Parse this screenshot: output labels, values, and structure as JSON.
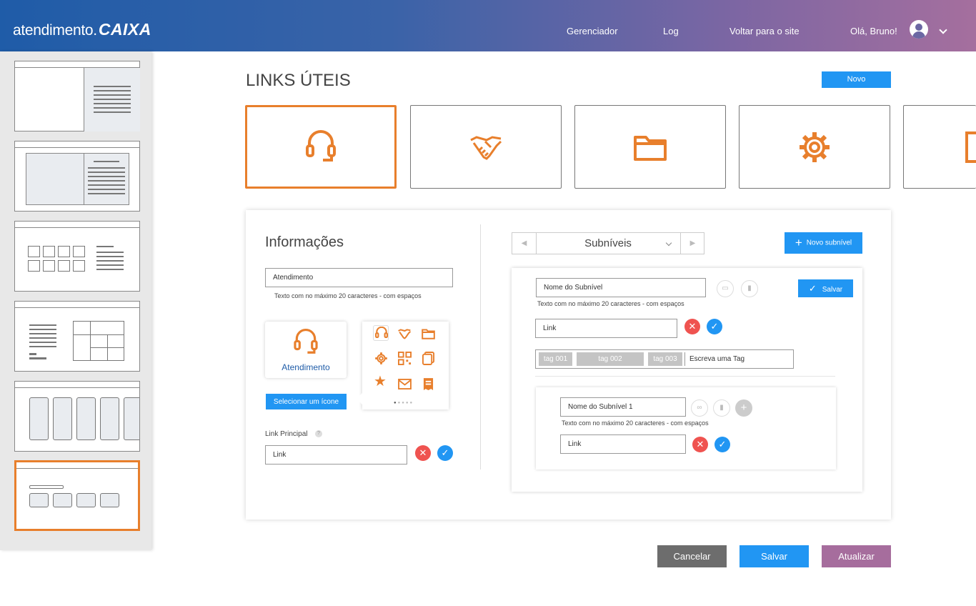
{
  "header": {
    "logo_text": "atendimento.",
    "logo_brand": "CAIXA",
    "nav": [
      "Gerenciador",
      "Log",
      "Voltar para o site"
    ],
    "greeting": "Olá, Bruno!"
  },
  "page": {
    "title": "LINKS ÚTEIS",
    "new_button": "Novo"
  },
  "icon_cards": [
    "headset-icon",
    "handshake-icon",
    "folder-icon",
    "gear-icon",
    "layout-icon"
  ],
  "info": {
    "heading": "Informações",
    "name_value": "Atendimento",
    "hint": "Texto com no máximo 20 caracteres - com espaços",
    "preview_label": "Atendimento",
    "select_icon_button": "Selecionar um ícone",
    "link_label": "Link Principal",
    "link_placeholder": "Link"
  },
  "subniveis": {
    "dropdown_label": "Subníveis",
    "new_button": "Novo subnível",
    "name_placeholder": "Nome do Subnível",
    "hint": "Texto com no máximo 20 caracteres - com espaços",
    "save_button": "Salvar",
    "link_placeholder": "Link",
    "tags": [
      "tag 001",
      "tag 002",
      "tag 003"
    ],
    "tag_placeholder": "Escreva uma Tag",
    "child": {
      "name_placeholder": "Nome do Subnível 1",
      "hint": "Texto com no máximo 20 caracteres - com espaços",
      "link_placeholder": "Link"
    }
  },
  "actions": {
    "cancel": "Cancelar",
    "save": "Salvar",
    "update": "Atualizar"
  },
  "colors": {
    "accent": "#e87f2c",
    "primary": "#2196f3",
    "danger": "#ef5350",
    "cancel": "#6d6d6d",
    "update": "#a66d9d"
  }
}
